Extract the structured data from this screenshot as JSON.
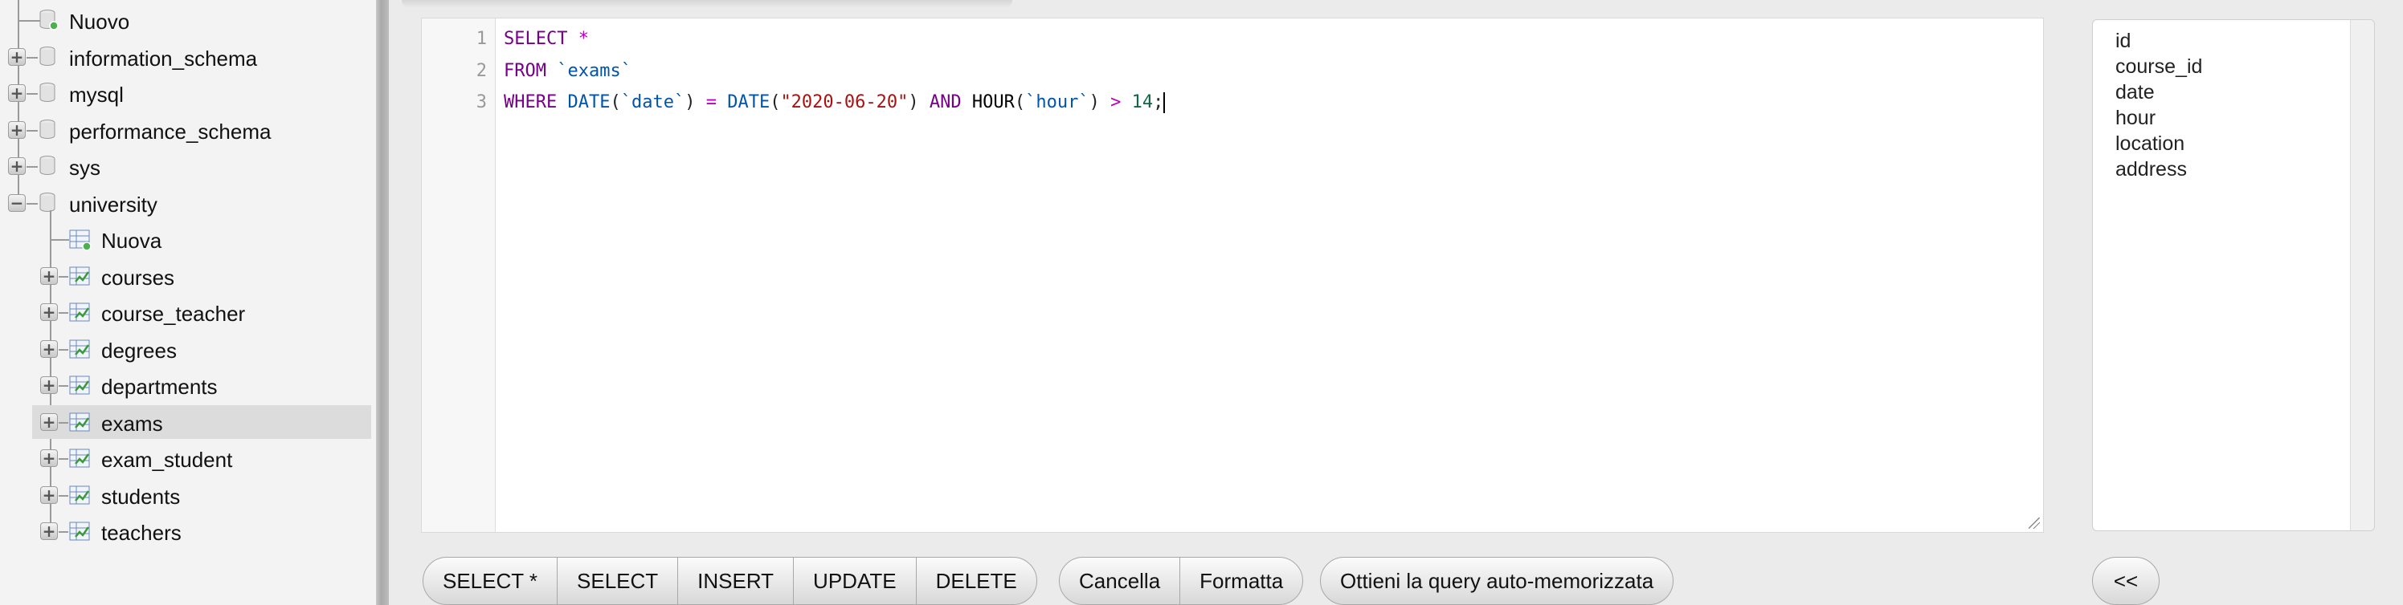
{
  "nav": {
    "top_items": [
      {
        "label": "Nuovo",
        "type": "new"
      },
      {
        "label": "information_schema",
        "type": "db"
      },
      {
        "label": "mysql",
        "type": "db"
      },
      {
        "label": "performance_schema",
        "type": "db"
      },
      {
        "label": "sys",
        "type": "db"
      },
      {
        "label": "university",
        "type": "db",
        "expanded": true
      }
    ],
    "university_children": [
      {
        "label": "Nuova",
        "type": "new-table"
      },
      {
        "label": "courses",
        "type": "table"
      },
      {
        "label": "course_teacher",
        "type": "table"
      },
      {
        "label": "degrees",
        "type": "table"
      },
      {
        "label": "departments",
        "type": "table"
      },
      {
        "label": "exams",
        "type": "table",
        "selected": true
      },
      {
        "label": "exam_student",
        "type": "table"
      },
      {
        "label": "students",
        "type": "table"
      },
      {
        "label": "teachers",
        "type": "table"
      }
    ],
    "expander_plus": "+",
    "expander_minus": "−"
  },
  "editor": {
    "line_numbers": [
      "1",
      "2",
      "3"
    ],
    "lines": [
      [
        {
          "t": "SELECT",
          "c": "kw"
        },
        {
          "t": " ",
          "c": ""
        },
        {
          "t": "*",
          "c": "op"
        }
      ],
      [
        {
          "t": "FROM",
          "c": "kw"
        },
        {
          "t": " ",
          "c": ""
        },
        {
          "t": "`exams`",
          "c": "bt"
        }
      ],
      [
        {
          "t": "WHERE",
          "c": "kw"
        },
        {
          "t": " ",
          "c": ""
        },
        {
          "t": "DATE",
          "c": "bt"
        },
        {
          "t": "(",
          "c": ""
        },
        {
          "t": "`date`",
          "c": "bt"
        },
        {
          "t": ")",
          "c": ""
        },
        {
          "t": " ",
          "c": ""
        },
        {
          "t": "=",
          "c": "op"
        },
        {
          "t": " ",
          "c": ""
        },
        {
          "t": "DATE",
          "c": "bt"
        },
        {
          "t": "(",
          "c": ""
        },
        {
          "t": "\"2020-06-20\"",
          "c": "str"
        },
        {
          "t": ")",
          "c": ""
        },
        {
          "t": " ",
          "c": ""
        },
        {
          "t": "AND",
          "c": "kw"
        },
        {
          "t": " ",
          "c": ""
        },
        {
          "t": "HOUR",
          "c": "fn"
        },
        {
          "t": "(",
          "c": ""
        },
        {
          "t": "`hour`",
          "c": "bt"
        },
        {
          "t": ")",
          "c": ""
        },
        {
          "t": " ",
          "c": ""
        },
        {
          "t": ">",
          "c": "op"
        },
        {
          "t": " ",
          "c": ""
        },
        {
          "t": "14",
          "c": "num"
        },
        {
          "t": ";",
          "c": ""
        }
      ]
    ]
  },
  "columns": [
    "id",
    "course_id",
    "date",
    "hour",
    "location",
    "address"
  ],
  "buttons": {
    "query_group": [
      "SELECT *",
      "SELECT",
      "INSERT",
      "UPDATE",
      "DELETE"
    ],
    "edit_group": [
      "Cancella",
      "Formatta"
    ],
    "autosave": "Ottieni la query auto-memorizzata",
    "insert_column": "<<"
  },
  "colors": {
    "keyword": "#770088",
    "operator": "#bb00bb",
    "identifier": "#0055aa",
    "string": "#aa1111",
    "number": "#116644",
    "selected_row": "#dcdcdc"
  }
}
